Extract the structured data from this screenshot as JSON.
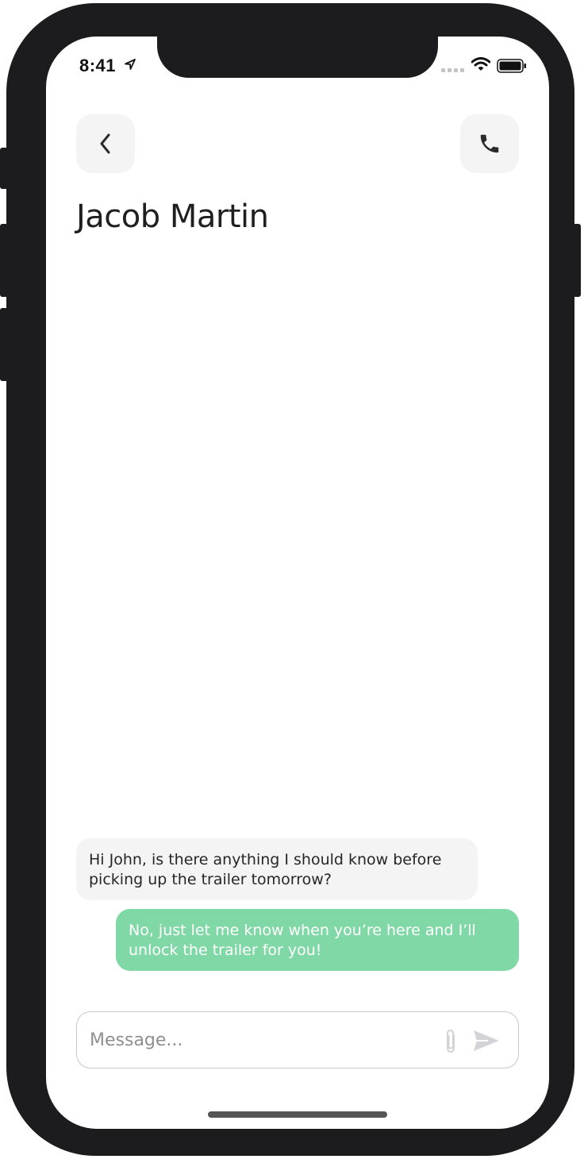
{
  "status_bar": {
    "time": "8:41",
    "icons": [
      "location-arrow-icon",
      "cellular-signal-icon",
      "wifi-icon",
      "battery-icon"
    ]
  },
  "header": {
    "back_icon": "chevron-left-icon",
    "call_icon": "phone-icon",
    "title": "Jacob Martin"
  },
  "messages": [
    {
      "direction": "incoming",
      "text": "Hi John, is there anything I should know before picking up the trailer tomorrow?"
    },
    {
      "direction": "outgoing",
      "text": "No, just let me know when you’re here and I’ll unlock the trailer for you!"
    }
  ],
  "composer": {
    "placeholder": "Message...",
    "value": "",
    "attach_icon": "paperclip-icon",
    "send_icon": "send-icon"
  },
  "colors": {
    "outgoing_bubble": "#80d8a6",
    "incoming_bubble": "#f4f4f5",
    "icon_button_bg": "#f4f4f5",
    "device_frame": "#1c1c1e"
  }
}
